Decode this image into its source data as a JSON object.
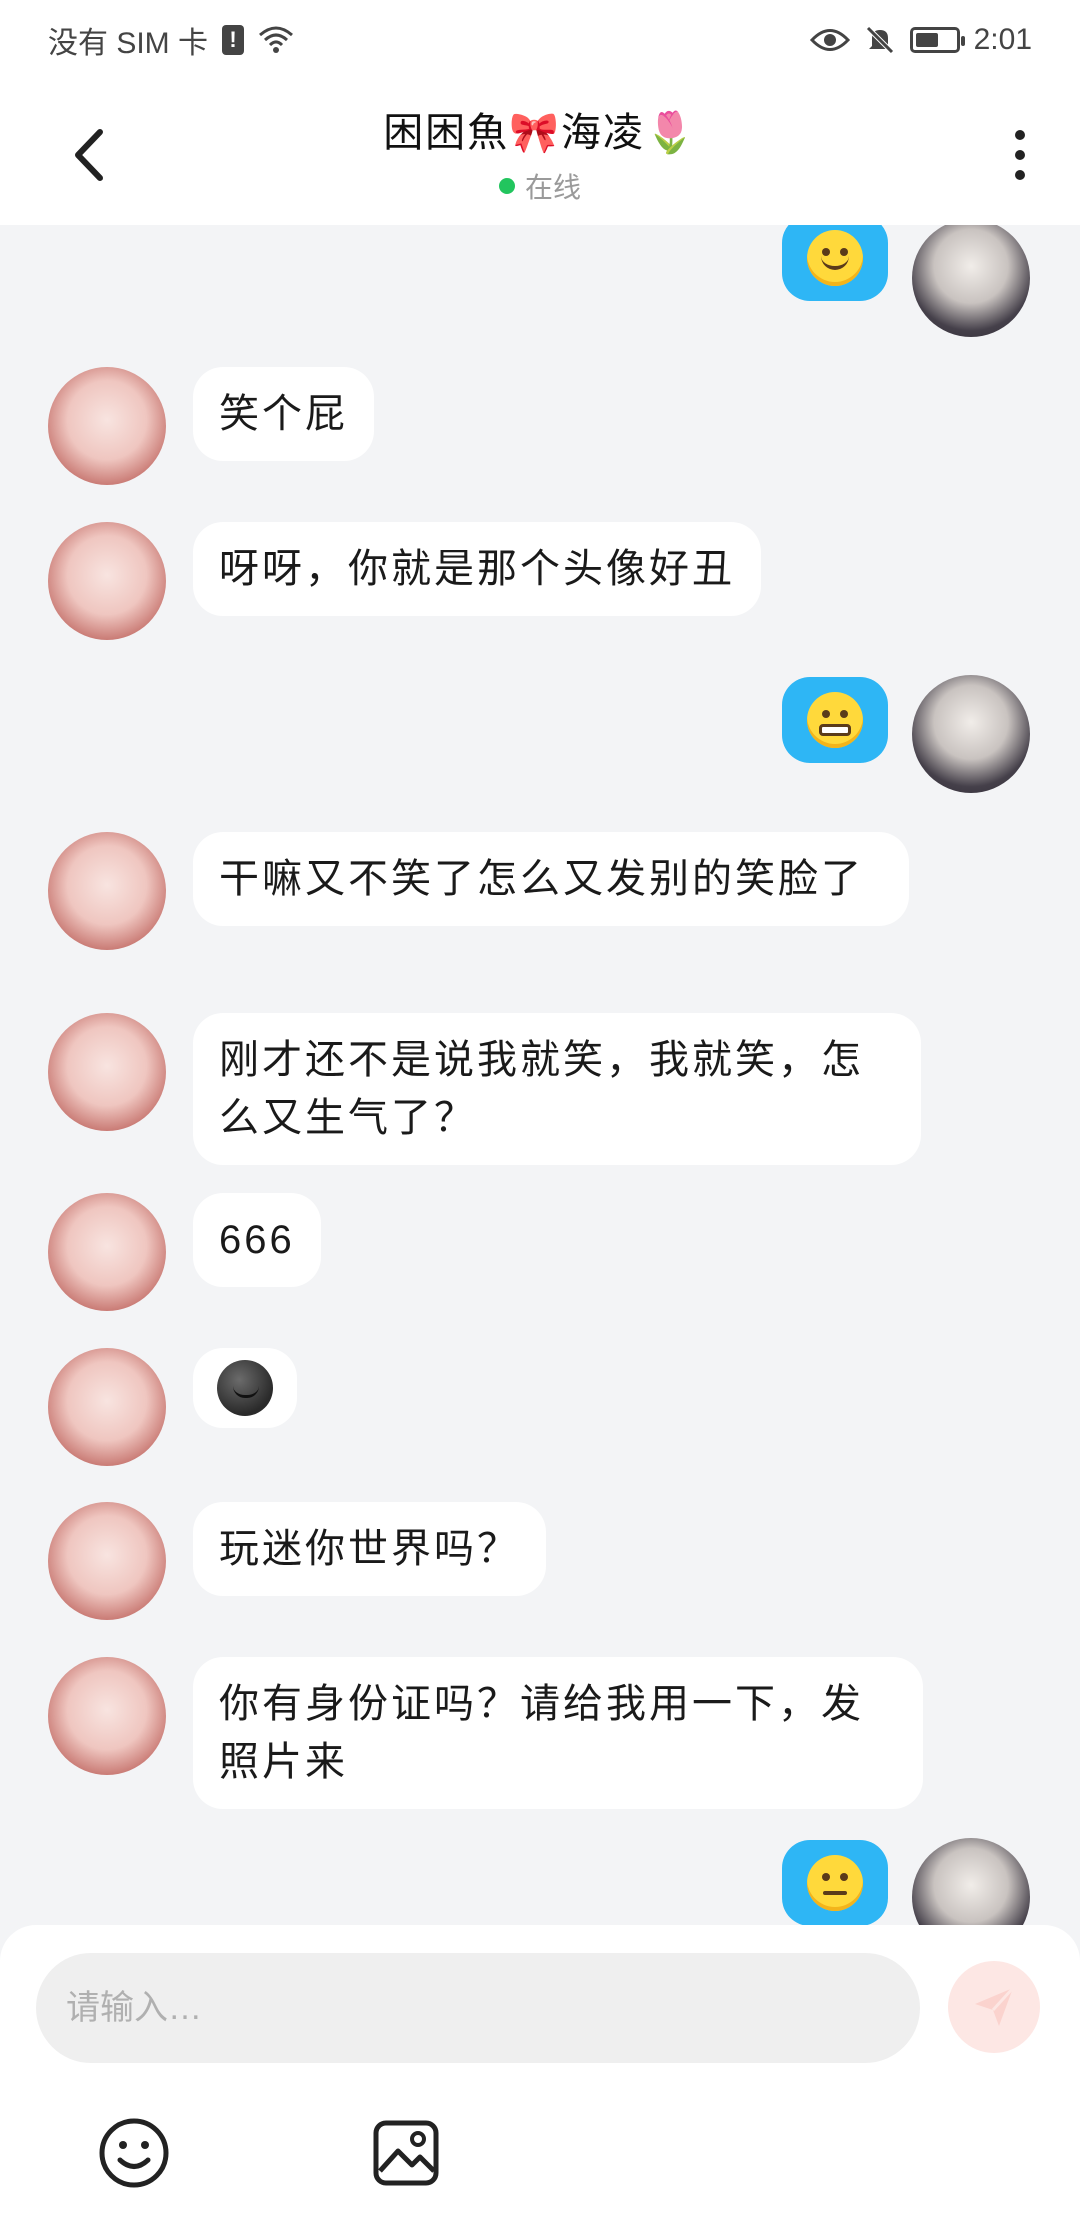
{
  "status_bar": {
    "carrier": "没有 SIM 卡",
    "time": "2:01",
    "icons": [
      "sim-alert-icon",
      "wifi-icon",
      "eye-icon",
      "mute-bell-icon",
      "battery-icon"
    ]
  },
  "header": {
    "title": "困困魚🎀海凌🌷",
    "status": "在线"
  },
  "messages": [
    {
      "side": "right",
      "type": "emoji",
      "emoji": "smiling-face-icon"
    },
    {
      "side": "left",
      "type": "text",
      "text": "笑个屁"
    },
    {
      "side": "left",
      "type": "text",
      "text": "呀呀，你就是那个头像好丑"
    },
    {
      "side": "right",
      "type": "emoji",
      "emoji": "grimacing-face-icon"
    },
    {
      "side": "left",
      "type": "text",
      "text": "干嘛又不笑了怎么又发别的笑脸了"
    },
    {
      "side": "left",
      "type": "text",
      "text": "刚才还不是说我就笑，我就笑，怎么又生气了？"
    },
    {
      "side": "left",
      "type": "text",
      "text": "666"
    },
    {
      "side": "left",
      "type": "emoji",
      "emoji": "moon-face-icon"
    },
    {
      "side": "left",
      "type": "text",
      "text": "玩迷你世界吗？"
    },
    {
      "side": "left",
      "type": "text",
      "text": "你有身份证吗？请给我用一下，发照片来"
    },
    {
      "side": "right",
      "type": "emoji",
      "emoji": "neutral-face-icon"
    }
  ],
  "input": {
    "placeholder": "请输入…"
  },
  "colors": {
    "accent_blue": "#2eb6f5",
    "online_green": "#22c55e",
    "send_disabled": "#fde7e4"
  }
}
